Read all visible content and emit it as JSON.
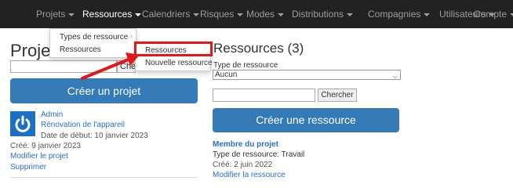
{
  "navbar": {
    "items": [
      {
        "label": "Projets",
        "has_caret": true,
        "active": false
      },
      {
        "label": "Ressources",
        "has_caret": true,
        "active": true
      },
      {
        "label": "Calendriers",
        "has_caret": true,
        "active": false
      },
      {
        "label": "Risques",
        "has_caret": true,
        "active": false
      },
      {
        "label": "Modes",
        "has_caret": true,
        "active": false
      },
      {
        "label": "Distributions",
        "has_caret": true,
        "active": false
      },
      {
        "label": "Compagnies",
        "has_caret": true,
        "active": false
      },
      {
        "label": "Utilisateurs",
        "has_caret": true,
        "active": false
      },
      {
        "label": "Compte",
        "has_caret": true,
        "active": false
      }
    ]
  },
  "ressources_menu": {
    "items": [
      {
        "label": "Types de ressource",
        "has_submenu": true
      },
      {
        "label": "Ressources",
        "has_submenu": true
      }
    ]
  },
  "ressources_submenu": {
    "items": [
      {
        "label": "Ressources",
        "highlighted": true
      },
      {
        "label": "Nouvelle ressource",
        "highlighted": false
      }
    ]
  },
  "left_panel": {
    "title": "Projets",
    "search_button_partial": "Ché",
    "create_button": "Créer un projet",
    "project": {
      "author": "Admin",
      "name": "Rénovation de l'appareil",
      "start_date": "Date de début: 10 janvier 2023",
      "created": "Créé: 9 janvier 2023",
      "edit_link": "Modifier le projet",
      "delete_link": "Supprimer"
    }
  },
  "right_panel": {
    "title": "Ressources (3)",
    "type_label": "Type de ressource",
    "type_select_value": "Aucun",
    "search_button": "Chercher",
    "create_button": "Créer une ressource",
    "resource": {
      "name": "Membre du projet",
      "type": "Type de ressource: Travail",
      "created": "Créé: 2 juin 2022",
      "edit_link": "Modifier la ressource"
    }
  },
  "colors": {
    "navbar_bg": "#222222",
    "primary": "#337ab7",
    "link": "#2a6fc4",
    "highlight": "#e01818",
    "avatar_bg": "#1b70c6"
  },
  "icons": {
    "avatar": "power-icon",
    "select_caret": "chevron-down-icon",
    "submenu_caret": "chevron-right-icon"
  }
}
